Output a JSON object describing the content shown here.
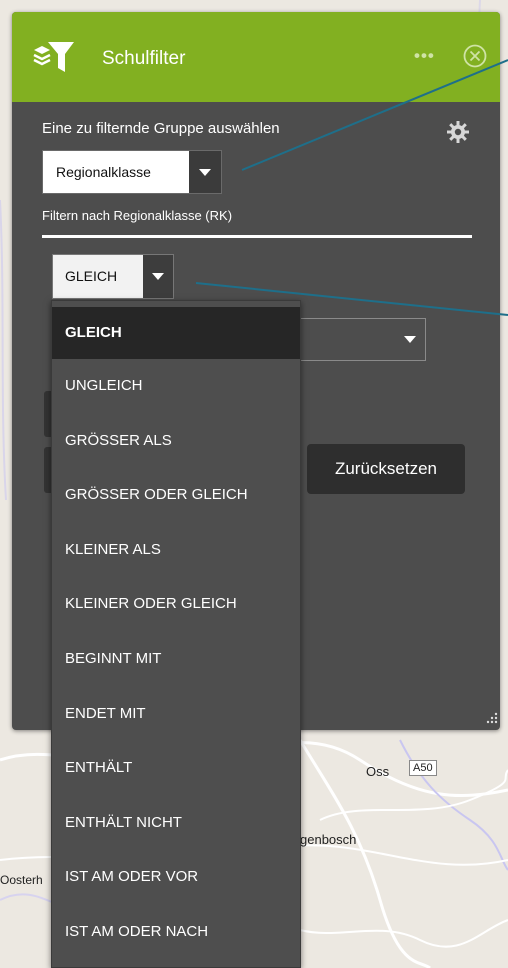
{
  "map": {
    "labels": {
      "oss": "Oss",
      "road": "A50",
      "city": "genbosch",
      "town": "Oosterh"
    }
  },
  "panel": {
    "title": "Schulfilter",
    "more_label": "•••",
    "group_label": "Eine zu filternde Gruppe auswählen",
    "group_select": {
      "value": "Regionalklasse"
    },
    "filter_caption": "Filtern nach Regionalklasse (RK)",
    "operator_select": {
      "value": "GLEICH"
    },
    "reset_label": "Zurücksetzen"
  },
  "operator_options": [
    {
      "label": "GLEICH",
      "selected": true
    },
    {
      "label": "UNGLEICH"
    },
    {
      "label": "GRÖSSER ALS"
    },
    {
      "label": "GRÖSSER ODER GLEICH"
    },
    {
      "label": "KLEINER ALS"
    },
    {
      "label": "KLEINER ODER GLEICH"
    },
    {
      "label": "BEGINNT MIT"
    },
    {
      "label": "ENDET MIT"
    },
    {
      "label": "ENTHÄLT"
    },
    {
      "label": "ENTHÄLT NICHT"
    },
    {
      "label": "IST AM ODER VOR"
    },
    {
      "label": "IST AM ODER NACH"
    }
  ],
  "colors": {
    "header_green": "#82b021",
    "panel_bg": "#4d4d4d",
    "callout_line": "#1e6f8a"
  },
  "icons": {
    "logo": "filter-funnel-icon",
    "more": "more-options-icon",
    "close": "close-icon",
    "settings": "gear-icon",
    "caret": "caret-down-icon",
    "resize": "resize-handle-icon"
  }
}
